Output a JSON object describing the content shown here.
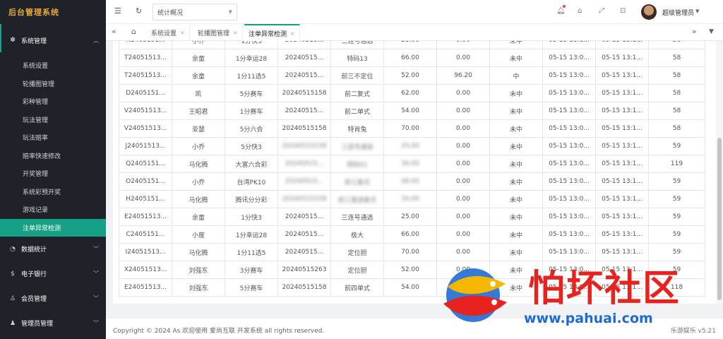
{
  "app": {
    "logo_text": "后台管理系统"
  },
  "sidebar": {
    "system_group": "系统管理",
    "items": [
      "系统设置",
      "轮播图管理",
      "彩种管理",
      "玩法管理",
      "玩法赔率",
      "赔率快速修改",
      "开奖管理",
      "系统彩预开奖",
      "游戏记录",
      "注单异常检测"
    ],
    "active_index": 9,
    "groups": [
      "数据统计",
      "电子银行",
      "会员管理",
      "管理员管理"
    ]
  },
  "header": {
    "select_value": "统计概况",
    "user_name": "超级管理员"
  },
  "tabs": [
    {
      "label": "系统设置"
    },
    {
      "label": "轮播图管理"
    },
    {
      "label": "注单异常检测",
      "active": true
    }
  ],
  "table": {
    "partial_top_row": [
      "N2405151...",
      "小乔",
      "1分快3",
      "20240515...",
      "三连号通选",
      "25.00",
      "0.00",
      "未中",
      "05-15 13:1...",
      "05-15 13:1...",
      "58"
    ],
    "rows": [
      [
        "T24051513...",
        "余童",
        "1分幸运28",
        "20240515...",
        "特码13",
        "66.00",
        "0.00",
        "未中",
        "05-15 13:0...",
        "05-15 13:1...",
        "58"
      ],
      [
        "T24051513...",
        "余童",
        "1分11选5",
        "20240515...",
        "前三不定位",
        "52.00",
        "96.20",
        "中",
        "05-15 13:0...",
        "05-15 13:1...",
        "58"
      ],
      [
        "D2405151...",
        "凯",
        "5分赛车",
        "20240515158",
        "前二复式",
        "62.00",
        "0.00",
        "未中",
        "05-15 13:0...",
        "05-15 13:1...",
        "58"
      ],
      [
        "V24051513...",
        "王昭君",
        "1分赛车",
        "20240515...",
        "前二单式",
        "54.00",
        "0.00",
        "未中",
        "05-15 13:0...",
        "05-15 13:1...",
        "58"
      ],
      [
        "V24051513...",
        "亚瑟",
        "5分六合",
        "20240515158",
        "特肖兔",
        "70.00",
        "0.00",
        "未中",
        "05-15 13:0...",
        "05-15 13:1...",
        "58"
      ],
      [
        "J24051513...",
        "小乔",
        "5分快3",
        "20240515158",
        "三连号通选",
        "25.00",
        "0.00",
        "未中",
        "05-15 13:0...",
        "05-15 13:1...",
        "59"
      ],
      [
        "Q2405151...",
        "马化腾",
        "大富六合彩",
        "20240515...",
        "特码01",
        "36.00",
        "0.00",
        "未中",
        "05-15 13:0...",
        "05-15 13:1...",
        "119"
      ],
      [
        "O2405151...",
        "小乔",
        "台湾PK10",
        "20240515...",
        "前三复式",
        "48.00",
        "0.00",
        "未中",
        "05-15 13:0...",
        "05-15 13:1...",
        "59"
      ],
      [
        "H2405151...",
        "马化腾",
        "腾讯分分彩",
        "20240515158",
        "前三直选复式",
        "34.00",
        "0.00",
        "未中",
        "05-15 13:0...",
        "05-15 13:1...",
        "59"
      ],
      [
        "E24051513...",
        "余童",
        "1分快3",
        "20240515...",
        "三连号通选",
        "25.00",
        "0.00",
        "未中",
        "05-15 13:0...",
        "05-15 13:1...",
        "59"
      ],
      [
        "C2405151...",
        "小度",
        "1分幸运28",
        "20240515...",
        "极大",
        "66.00",
        "0.00",
        "未中",
        "05-15 13:0...",
        "05-15 13:1...",
        "59"
      ],
      [
        "I24051513...",
        "马化腾",
        "1分11选5",
        "20240515...",
        "定位胆",
        "70.00",
        "0.00",
        "未中",
        "05-15 13:0...",
        "05-15 13:1...",
        "59"
      ],
      [
        "X24051513...",
        "刘强东",
        "3分赛车",
        "20240515263",
        "定位胆",
        "52.00",
        "0.00",
        "未中",
        "05-15 13:0...",
        "05-15 13:1...",
        "59"
      ],
      [
        "E24051513...",
        "刘强东",
        "5分赛车",
        "20240515158",
        "前四单式",
        "54.00",
        "0.00",
        "未中",
        "05-15 13:0...",
        "05-15 13:1...",
        "118"
      ]
    ]
  },
  "footer": {
    "copyright": "Copyright © 2024 As 欢迎使用 爱尚互联 开发系统 all rights reserved.",
    "version": "乐游娱乐 v5.21"
  },
  "watermark": {
    "text": "怕坏社区",
    "url": "www.pahuai.com"
  },
  "colors": {
    "accent": "#16a085",
    "sidebar_bg": "#20222a"
  }
}
